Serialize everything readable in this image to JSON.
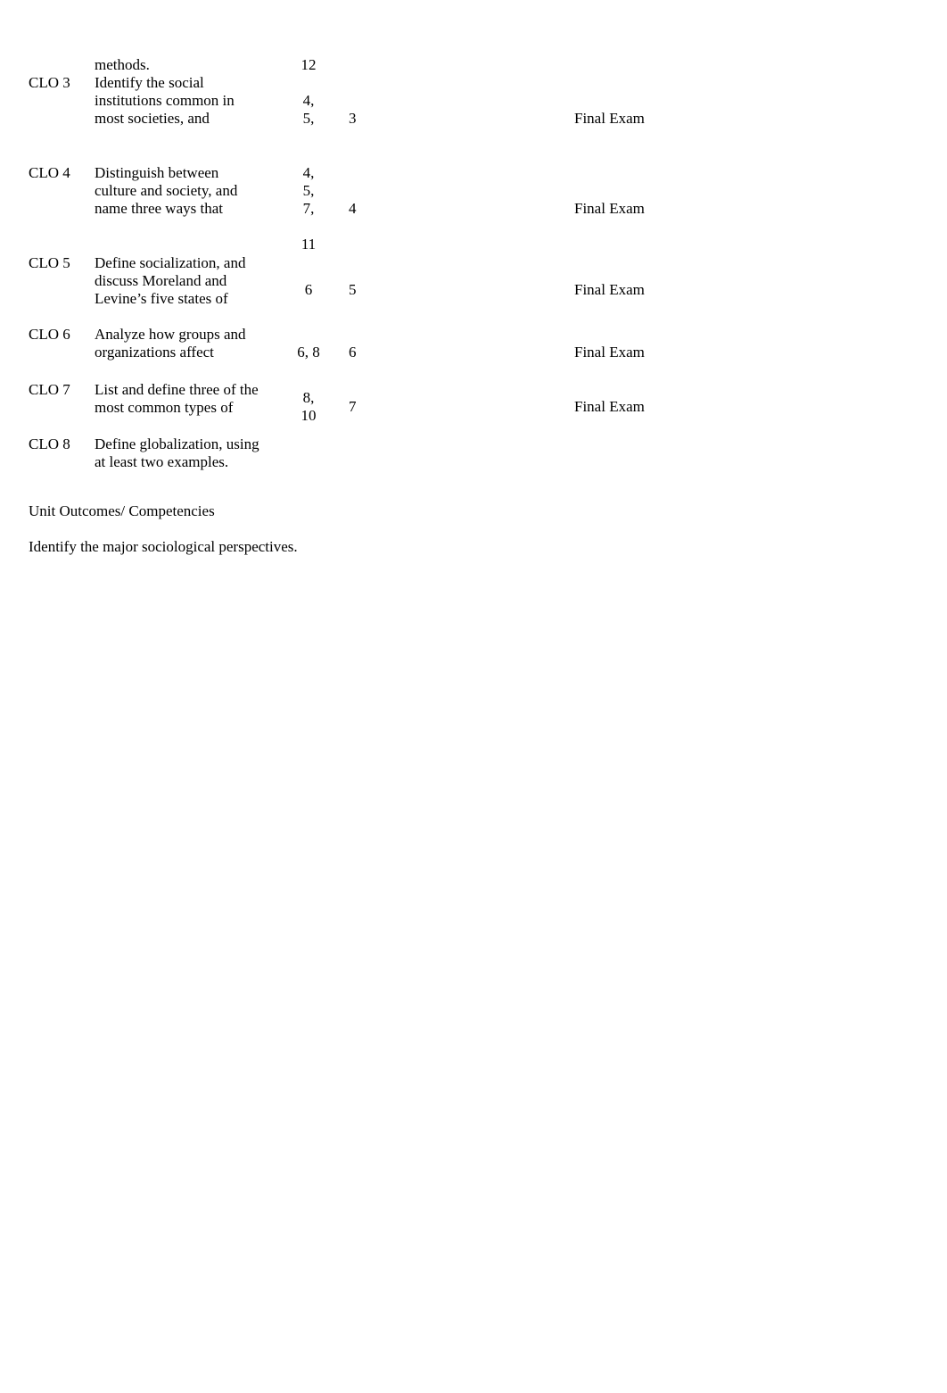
{
  "top_fragment": {
    "description": "methods.",
    "weeks": "12"
  },
  "rows": [
    {
      "clo": "CLO 3",
      "description": [
        "Identify the social",
        "institutions common in",
        "most societies, and"
      ],
      "weeks": [
        "4,",
        "5,"
      ],
      "unit": "3",
      "assessment": "Final Exam"
    },
    {
      "clo": "CLO 4",
      "description": [
        "Distinguish between",
        "culture and society, and",
        "name three ways that"
      ],
      "weeks": [
        "4,",
        "5,",
        "7,"
      ],
      "unit": "4",
      "assessment": "Final Exam"
    },
    {
      "clo": "CLO 5",
      "description": [
        "Define socialization, and",
        "discuss Moreland and",
        "Levine’s five states of"
      ],
      "weeks": [
        "6"
      ],
      "unit": "5",
      "assessment": "Final Exam",
      "weeks_carryover": "11"
    },
    {
      "clo": "CLO 6",
      "description": [
        "Analyze how groups and",
        "organizations affect"
      ],
      "weeks": [
        "6, 8"
      ],
      "unit": "6",
      "assessment": "Final Exam"
    },
    {
      "clo": "CLO 7",
      "description": [
        "List and define three of the",
        "most common types of"
      ],
      "weeks": [
        "8,",
        "10"
      ],
      "unit": "7",
      "assessment": "Final Exam"
    },
    {
      "clo": "CLO 8",
      "description": [
        "Define globalization, using",
        "at least two examples."
      ],
      "weeks": [],
      "unit": "",
      "assessment": ""
    }
  ],
  "unit_outcomes_heading": "Unit Outcomes/ Competencies",
  "unit_outcome_1": "Identify the major sociological perspectives."
}
